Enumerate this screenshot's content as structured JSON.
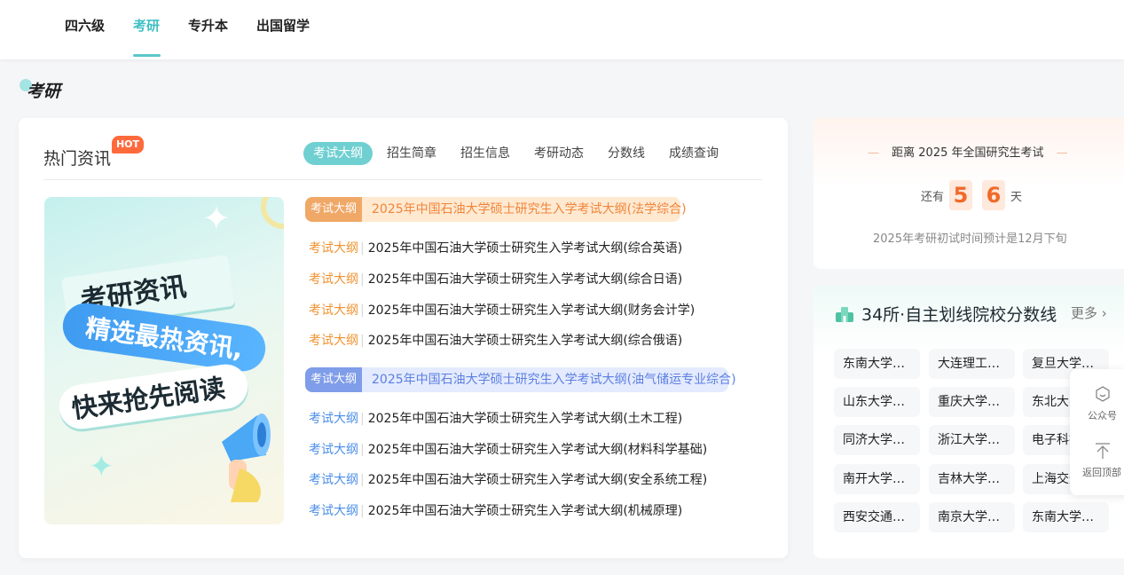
{
  "nav": {
    "tabs": [
      {
        "label": "四六级"
      },
      {
        "label": "考研",
        "active": true
      },
      {
        "label": "专升本"
      },
      {
        "label": "出国留学"
      }
    ]
  },
  "section": {
    "title": "考研"
  },
  "news": {
    "title": "热门资讯",
    "badge": "HOT",
    "subtabs": [
      "考试大纲",
      "招生简章",
      "招生信息",
      "考研动态",
      "分数线",
      "成绩查询"
    ],
    "banner": {
      "line1": "考研资讯",
      "line2": "精选最热资讯,",
      "line3": "快来抢先阅读"
    },
    "featured": [
      {
        "tag": "考试大纲",
        "title": "2025年中国石油大学硕士研究生入学考试大纲(法学综合)",
        "color": "#f0853a"
      },
      {
        "tag": "考试大纲",
        "title": "2025年中国石油大学硕士研究生入学考试大纲(油气储运专业综合)",
        "color": "#5c7fe0"
      }
    ],
    "items": [
      {
        "category": "考试大纲",
        "title": "2025年中国石油大学硕士研究生入学考试大纲(综合英语)",
        "color": "orange"
      },
      {
        "category": "考试大纲",
        "title": "2025年中国石油大学硕士研究生入学考试大纲(综合日语)",
        "color": "orange"
      },
      {
        "category": "考试大纲",
        "title": "2025年中国石油大学硕士研究生入学考试大纲(财务会计学)",
        "color": "orange"
      },
      {
        "category": "考试大纲",
        "title": "2025年中国石油大学硕士研究生入学考试大纲(综合俄语)",
        "color": "orange"
      },
      {
        "category": "考试大纲",
        "title": "2025年中国石油大学硕士研究生入学考试大纲(土木工程)",
        "color": "blue"
      },
      {
        "category": "考试大纲",
        "title": "2025年中国石油大学硕士研究生入学考试大纲(材料科学基础)",
        "color": "blue"
      },
      {
        "category": "考试大纲",
        "title": "2025年中国石油大学硕士研究生入学考试大纲(安全系统工程)",
        "color": "blue"
      },
      {
        "category": "考试大纲",
        "title": "2025年中国石油大学硕士研究生入学考试大纲(机械原理)",
        "color": "blue"
      }
    ],
    "separator": "|"
  },
  "countdown": {
    "dash": "—",
    "heading": "距离 2025 年全国研究生考试",
    "prefix": "还有",
    "digits": [
      "5",
      "6"
    ],
    "suffix": "天",
    "note": "2025年考研初试时间预计是12月下旬"
  },
  "schools": {
    "title": "34所·自主划线院校分数线",
    "more": "更多",
    "more_icon": "chevron-right-icon",
    "list": [
      "东南大学…",
      "大连理工…",
      "复旦大学…",
      "山东大学…",
      "重庆大学…",
      "东北大学…",
      "同济大学…",
      "浙江大学…",
      "电子科技…",
      "南开大学…",
      "吉林大学…",
      "上海交通…",
      "西安交通…",
      "南京大学…",
      "东南大学…"
    ]
  },
  "side_tools": [
    {
      "label": "公众号",
      "icon": "wechat-official-icon"
    },
    {
      "label": "返回顶部",
      "icon": "back-to-top-icon"
    }
  ],
  "colors": {
    "accent": "#5cc7cc",
    "hot": "#ff6a3d",
    "countdown": "#f06a2a"
  }
}
